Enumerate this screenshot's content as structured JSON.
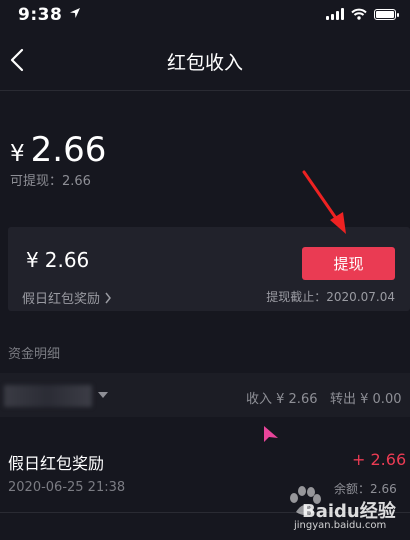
{
  "status_bar": {
    "time": "9:38"
  },
  "header": {
    "title": "红包收入"
  },
  "balance": {
    "currency": "¥",
    "amount": "2.66",
    "withdrawable": "可提现：2.66"
  },
  "card": {
    "currency": "¥",
    "amount": "2.66",
    "source": "假日红包奖励",
    "button_label": "提现",
    "deadline": "提现截止：2020.07.04"
  },
  "details": {
    "section_title": "资金明细",
    "income_summary": "收入 ¥ 2.66",
    "expense_summary": "转出 ¥ 0.00",
    "records": [
      {
        "title": "假日红包奖励",
        "time": "2020-06-25 21:38",
        "amount": "+ 2.66",
        "balance": "余额：2.66"
      }
    ]
  },
  "watermark": {
    "brand": "Baidu经验",
    "url": "jingyan.baidu.com"
  },
  "colors": {
    "accent": "#ea3b53",
    "background": "#16171f",
    "card": "#21222b"
  }
}
